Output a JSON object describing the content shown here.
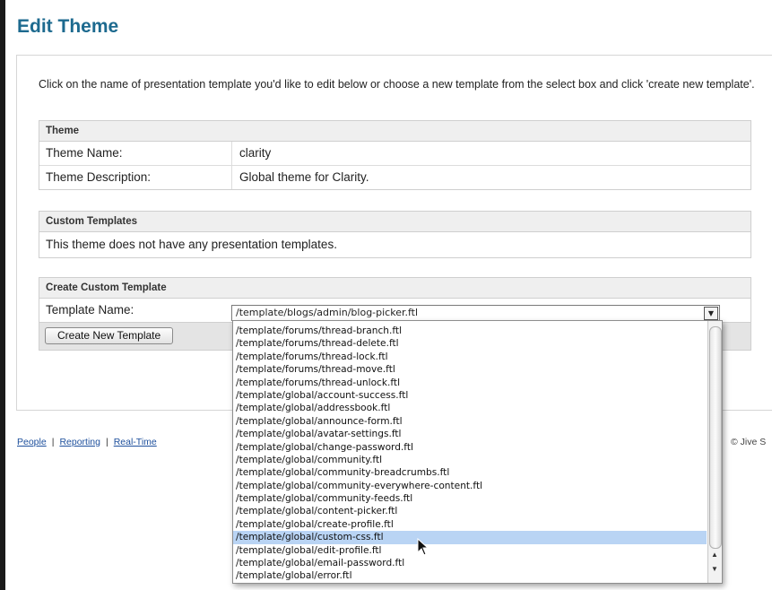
{
  "page": {
    "title": "Edit Theme"
  },
  "intro": "Click on the name of presentation template you'd like to edit below or choose a new template from the select box and click 'create new template'.",
  "theme_panel": {
    "header": "Theme",
    "name_label": "Theme Name:",
    "name_value": "clarity",
    "desc_label": "Theme Description:",
    "desc_value": "Global theme for Clarity."
  },
  "custom_panel": {
    "header": "Custom Templates",
    "message": "This theme does not have any presentation templates."
  },
  "create_panel": {
    "header": "Create Custom Template",
    "template_label": "Template Name:",
    "selected_value": "/template/blogs/admin/blog-picker.ftl",
    "button_label": "Create New Template"
  },
  "footer": {
    "links": [
      "People",
      "Reporting",
      "Real-Time"
    ],
    "copyright": "© Jive S"
  },
  "dropdown": {
    "highlighted": "/template/global/custom-css.ftl",
    "options": [
      "/template/forums/thread-branch.ftl",
      "/template/forums/thread-delete.ftl",
      "/template/forums/thread-lock.ftl",
      "/template/forums/thread-move.ftl",
      "/template/forums/thread-unlock.ftl",
      "/template/global/account-success.ftl",
      "/template/global/addressbook.ftl",
      "/template/global/announce-form.ftl",
      "/template/global/avatar-settings.ftl",
      "/template/global/change-password.ftl",
      "/template/global/community.ftl",
      "/template/global/community-breadcrumbs.ftl",
      "/template/global/community-everywhere-content.ftl",
      "/template/global/community-feeds.ftl",
      "/template/global/content-picker.ftl",
      "/template/global/create-profile.ftl",
      "/template/global/custom-css.ftl",
      "/template/global/edit-profile.ftl",
      "/template/global/email-password.ftl",
      "/template/global/error.ftl"
    ]
  },
  "colors": {
    "title": "#1d6a8f",
    "link": "#1d4f9c",
    "highlight": "#b9d4f4"
  }
}
